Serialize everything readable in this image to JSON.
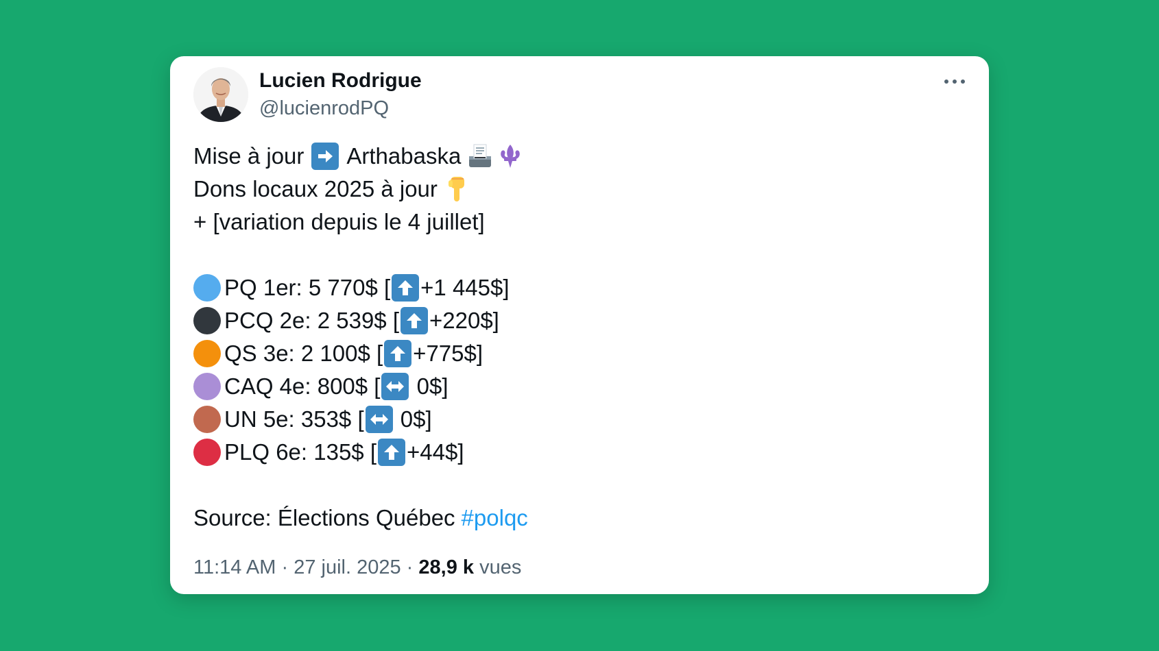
{
  "author": {
    "name": "Lucien Rodrigue",
    "handle": "@lucienrodPQ"
  },
  "tweet": {
    "line1_prefix": "Mise à jour",
    "line1_suffix": "Arthabaska",
    "line2": "Dons locaux 2025 à jour",
    "line3": "+ [variation depuis le 4 juillet]",
    "rows": [
      {
        "color": "#55acee",
        "text1": "PQ 1er: 5 770$ [",
        "icon": "up-arrow-icon",
        "text2": "+1 445$]"
      },
      {
        "color": "#31373d",
        "text1": "PCQ 2e: 2 539$ [",
        "icon": "up-arrow-icon",
        "text2": "+220$]"
      },
      {
        "color": "#f4900c",
        "text1": "QS 3e: 2 100$ [",
        "icon": "up-arrow-icon",
        "text2": "+775$]"
      },
      {
        "color": "#aa8ed6",
        "text1": "CAQ 4e: 800$ [",
        "icon": "left-right-arrow-icon",
        "text2": " 0$]"
      },
      {
        "color": "#c1694f",
        "text1": "UN 5e: 353$ [",
        "icon": "left-right-arrow-icon",
        "text2": " 0$]"
      },
      {
        "color": "#dd2e44",
        "text1": "PLQ 6e: 135$ [",
        "icon": "up-arrow-icon",
        "text2": "+44$]"
      }
    ],
    "source_text": "Source: Élections Québec",
    "hashtag": "#polqc"
  },
  "meta": {
    "time": "11:14 AM",
    "sep": "·",
    "date": "27 juil. 2025",
    "views_count": "28,9 k",
    "views_label": "vues"
  },
  "colors": {
    "background": "#17a86e",
    "link": "#1d9bf0",
    "muted": "#536471",
    "emoji_box": "#3b88c3"
  }
}
